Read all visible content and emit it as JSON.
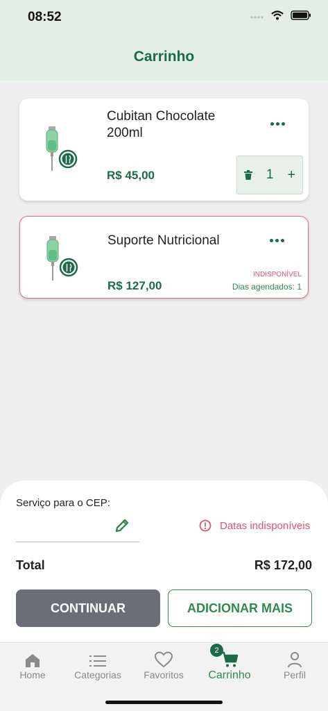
{
  "status": {
    "time": "08:52"
  },
  "header": {
    "title": "Carrinho"
  },
  "cart": {
    "items": [
      {
        "name": "Cubitan Chocolate 200ml",
        "price": "R$ 45,00",
        "quantity": "1"
      },
      {
        "name": "Suporte Nutricional",
        "price": "R$ 127,00",
        "status": "INDISPONÍVEL",
        "days": "Dias agendados: 1"
      }
    ]
  },
  "summary": {
    "cep_label": "Serviço para o CEP:",
    "cep_value": "",
    "warning": "Datas indisponíveis",
    "total_label": "Total",
    "total_value": "R$ 172,00",
    "continue_label": "CONTINUAR",
    "add_more_label": "ADICIONAR MAIS"
  },
  "tabbar": {
    "tabs": [
      {
        "label": "Home",
        "icon": "home-icon"
      },
      {
        "label": "Categorias",
        "icon": "list-icon"
      },
      {
        "label": "Favoritos",
        "icon": "heart-icon"
      },
      {
        "label": "Carrinho",
        "icon": "cart-icon",
        "active": true,
        "badge": "2"
      },
      {
        "label": "Perfil",
        "icon": "user-icon"
      }
    ]
  },
  "colors": {
    "brand": "#1c6b48",
    "accent": "#2f8a4f",
    "danger": "#e0546c",
    "header_bg": "#e3efe5"
  }
}
